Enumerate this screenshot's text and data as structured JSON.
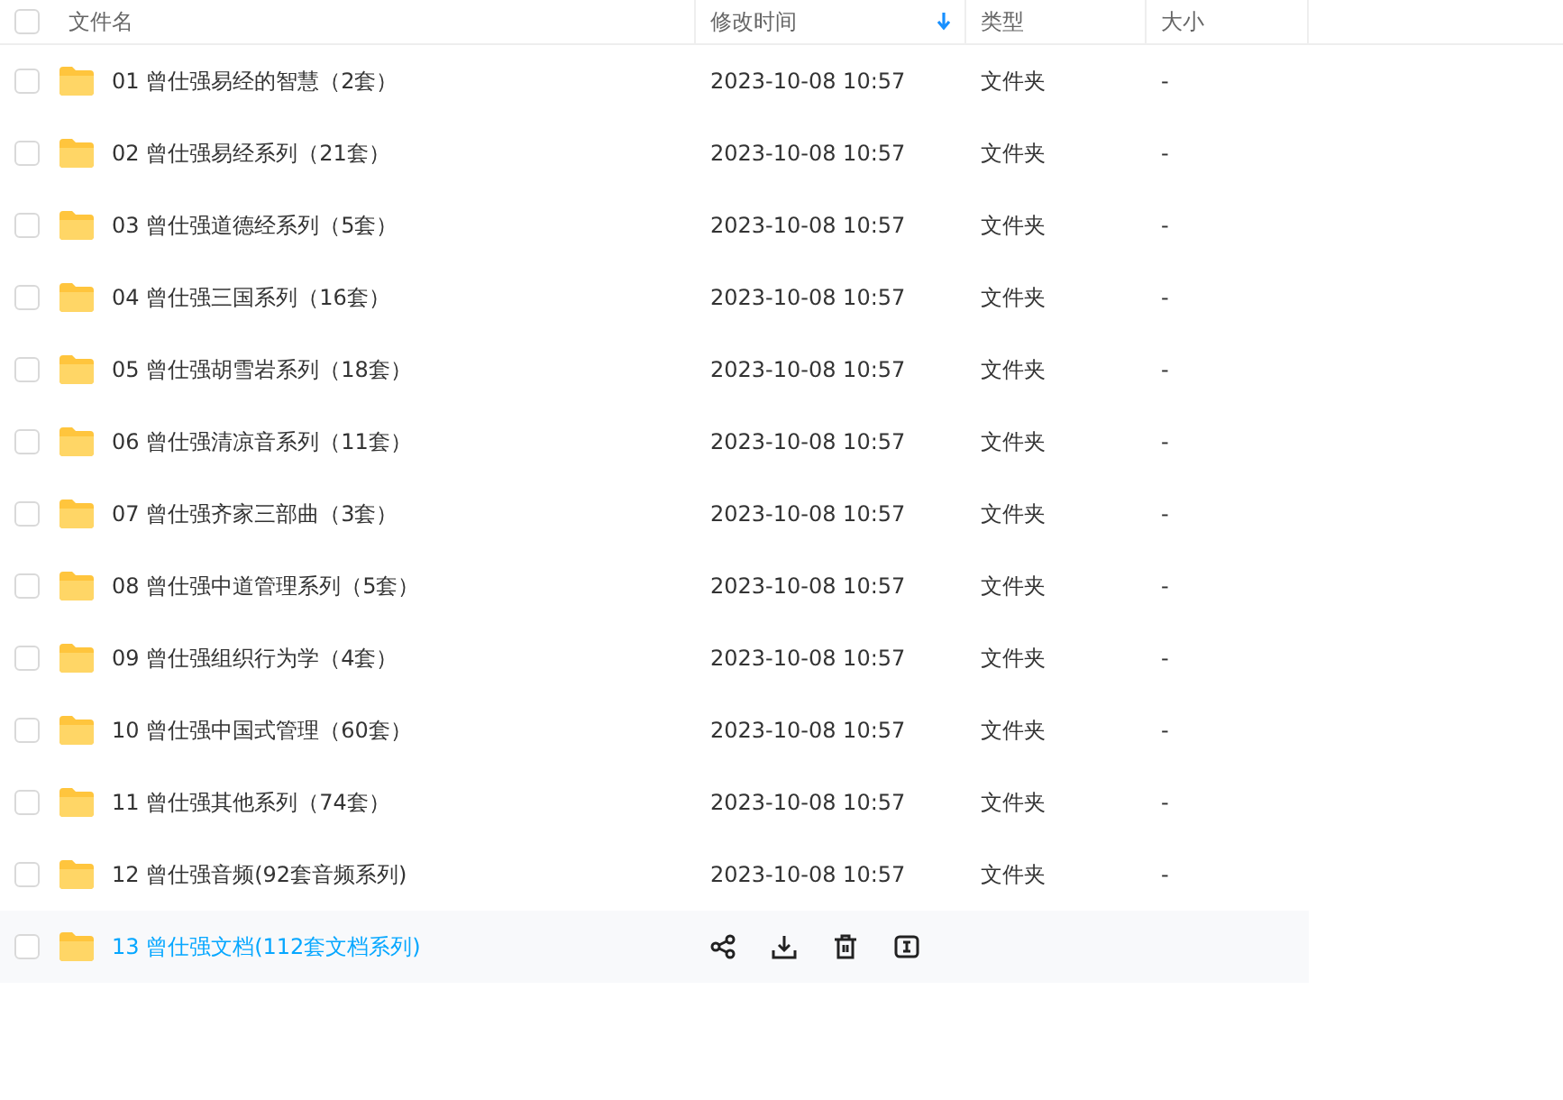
{
  "header": {
    "checked": false,
    "columns": [
      {
        "label": "文件名",
        "sorted": false
      },
      {
        "label": "修改时间",
        "sorted": true
      },
      {
        "label": "类型",
        "sorted": false
      },
      {
        "label": "大小",
        "sorted": false
      }
    ]
  },
  "rows": [
    {
      "name": "01 曾仕强易经的智慧（2套）",
      "modified": "2023-10-08 10:57",
      "type": "文件夹",
      "size": "-",
      "checked": false,
      "hovered": false
    },
    {
      "name": "02 曾仕强易经系列（21套）",
      "modified": "2023-10-08 10:57",
      "type": "文件夹",
      "size": "-",
      "checked": false,
      "hovered": false
    },
    {
      "name": "03 曾仕强道德经系列（5套）",
      "modified": "2023-10-08 10:57",
      "type": "文件夹",
      "size": "-",
      "checked": false,
      "hovered": false
    },
    {
      "name": "04 曾仕强三国系列（16套）",
      "modified": "2023-10-08 10:57",
      "type": "文件夹",
      "size": "-",
      "checked": false,
      "hovered": false
    },
    {
      "name": "05 曾仕强胡雪岩系列（18套）",
      "modified": "2023-10-08 10:57",
      "type": "文件夹",
      "size": "-",
      "checked": false,
      "hovered": false
    },
    {
      "name": "06 曾仕强清凉音系列（11套）",
      "modified": "2023-10-08 10:57",
      "type": "文件夹",
      "size": "-",
      "checked": false,
      "hovered": false
    },
    {
      "name": "07 曾仕强齐家三部曲（3套）",
      "modified": "2023-10-08 10:57",
      "type": "文件夹",
      "size": "-",
      "checked": false,
      "hovered": false
    },
    {
      "name": "08 曾仕强中道管理系列（5套）",
      "modified": "2023-10-08 10:57",
      "type": "文件夹",
      "size": "-",
      "checked": false,
      "hovered": false
    },
    {
      "name": "09 曾仕强组织行为学（4套）",
      "modified": "2023-10-08 10:57",
      "type": "文件夹",
      "size": "-",
      "checked": false,
      "hovered": false
    },
    {
      "name": "10 曾仕强中国式管理（60套）",
      "modified": "2023-10-08 10:57",
      "type": "文件夹",
      "size": "-",
      "checked": false,
      "hovered": false
    },
    {
      "name": "11 曾仕强其他系列（74套）",
      "modified": "2023-10-08 10:57",
      "type": "文件夹",
      "size": "-",
      "checked": false,
      "hovered": false
    },
    {
      "name": "12 曾仕强音频(92套音频系列)",
      "modified": "2023-10-08 10:57",
      "type": "文件夹",
      "size": "-",
      "checked": false,
      "hovered": false
    },
    {
      "name": "13 曾仕强文档(112套文档系列)",
      "checked": false,
      "hovered": true
    }
  ]
}
